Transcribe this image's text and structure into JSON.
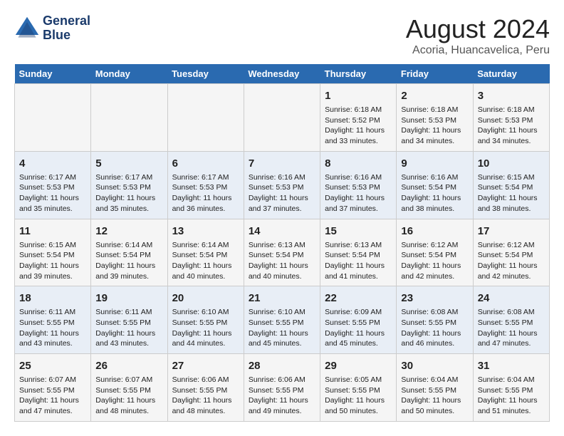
{
  "logo": {
    "line1": "General",
    "line2": "Blue"
  },
  "title": "August 2024",
  "subtitle": "Acoria, Huancavelica, Peru",
  "weekdays": [
    "Sunday",
    "Monday",
    "Tuesday",
    "Wednesday",
    "Thursday",
    "Friday",
    "Saturday"
  ],
  "weeks": [
    [
      {
        "day": "",
        "content": ""
      },
      {
        "day": "",
        "content": ""
      },
      {
        "day": "",
        "content": ""
      },
      {
        "day": "",
        "content": ""
      },
      {
        "day": "1",
        "content": "Sunrise: 6:18 AM\nSunset: 5:52 PM\nDaylight: 11 hours\nand 33 minutes."
      },
      {
        "day": "2",
        "content": "Sunrise: 6:18 AM\nSunset: 5:53 PM\nDaylight: 11 hours\nand 34 minutes."
      },
      {
        "day": "3",
        "content": "Sunrise: 6:18 AM\nSunset: 5:53 PM\nDaylight: 11 hours\nand 34 minutes."
      }
    ],
    [
      {
        "day": "4",
        "content": "Sunrise: 6:17 AM\nSunset: 5:53 PM\nDaylight: 11 hours\nand 35 minutes."
      },
      {
        "day": "5",
        "content": "Sunrise: 6:17 AM\nSunset: 5:53 PM\nDaylight: 11 hours\nand 35 minutes."
      },
      {
        "day": "6",
        "content": "Sunrise: 6:17 AM\nSunset: 5:53 PM\nDaylight: 11 hours\nand 36 minutes."
      },
      {
        "day": "7",
        "content": "Sunrise: 6:16 AM\nSunset: 5:53 PM\nDaylight: 11 hours\nand 37 minutes."
      },
      {
        "day": "8",
        "content": "Sunrise: 6:16 AM\nSunset: 5:53 PM\nDaylight: 11 hours\nand 37 minutes."
      },
      {
        "day": "9",
        "content": "Sunrise: 6:16 AM\nSunset: 5:54 PM\nDaylight: 11 hours\nand 38 minutes."
      },
      {
        "day": "10",
        "content": "Sunrise: 6:15 AM\nSunset: 5:54 PM\nDaylight: 11 hours\nand 38 minutes."
      }
    ],
    [
      {
        "day": "11",
        "content": "Sunrise: 6:15 AM\nSunset: 5:54 PM\nDaylight: 11 hours\nand 39 minutes."
      },
      {
        "day": "12",
        "content": "Sunrise: 6:14 AM\nSunset: 5:54 PM\nDaylight: 11 hours\nand 39 minutes."
      },
      {
        "day": "13",
        "content": "Sunrise: 6:14 AM\nSunset: 5:54 PM\nDaylight: 11 hours\nand 40 minutes."
      },
      {
        "day": "14",
        "content": "Sunrise: 6:13 AM\nSunset: 5:54 PM\nDaylight: 11 hours\nand 40 minutes."
      },
      {
        "day": "15",
        "content": "Sunrise: 6:13 AM\nSunset: 5:54 PM\nDaylight: 11 hours\nand 41 minutes."
      },
      {
        "day": "16",
        "content": "Sunrise: 6:12 AM\nSunset: 5:54 PM\nDaylight: 11 hours\nand 42 minutes."
      },
      {
        "day": "17",
        "content": "Sunrise: 6:12 AM\nSunset: 5:54 PM\nDaylight: 11 hours\nand 42 minutes."
      }
    ],
    [
      {
        "day": "18",
        "content": "Sunrise: 6:11 AM\nSunset: 5:55 PM\nDaylight: 11 hours\nand 43 minutes."
      },
      {
        "day": "19",
        "content": "Sunrise: 6:11 AM\nSunset: 5:55 PM\nDaylight: 11 hours\nand 43 minutes."
      },
      {
        "day": "20",
        "content": "Sunrise: 6:10 AM\nSunset: 5:55 PM\nDaylight: 11 hours\nand 44 minutes."
      },
      {
        "day": "21",
        "content": "Sunrise: 6:10 AM\nSunset: 5:55 PM\nDaylight: 11 hours\nand 45 minutes."
      },
      {
        "day": "22",
        "content": "Sunrise: 6:09 AM\nSunset: 5:55 PM\nDaylight: 11 hours\nand 45 minutes."
      },
      {
        "day": "23",
        "content": "Sunrise: 6:08 AM\nSunset: 5:55 PM\nDaylight: 11 hours\nand 46 minutes."
      },
      {
        "day": "24",
        "content": "Sunrise: 6:08 AM\nSunset: 5:55 PM\nDaylight: 11 hours\nand 47 minutes."
      }
    ],
    [
      {
        "day": "25",
        "content": "Sunrise: 6:07 AM\nSunset: 5:55 PM\nDaylight: 11 hours\nand 47 minutes."
      },
      {
        "day": "26",
        "content": "Sunrise: 6:07 AM\nSunset: 5:55 PM\nDaylight: 11 hours\nand 48 minutes."
      },
      {
        "day": "27",
        "content": "Sunrise: 6:06 AM\nSunset: 5:55 PM\nDaylight: 11 hours\nand 48 minutes."
      },
      {
        "day": "28",
        "content": "Sunrise: 6:06 AM\nSunset: 5:55 PM\nDaylight: 11 hours\nand 49 minutes."
      },
      {
        "day": "29",
        "content": "Sunrise: 6:05 AM\nSunset: 5:55 PM\nDaylight: 11 hours\nand 50 minutes."
      },
      {
        "day": "30",
        "content": "Sunrise: 6:04 AM\nSunset: 5:55 PM\nDaylight: 11 hours\nand 50 minutes."
      },
      {
        "day": "31",
        "content": "Sunrise: 6:04 AM\nSunset: 5:55 PM\nDaylight: 11 hours\nand 51 minutes."
      }
    ]
  ]
}
